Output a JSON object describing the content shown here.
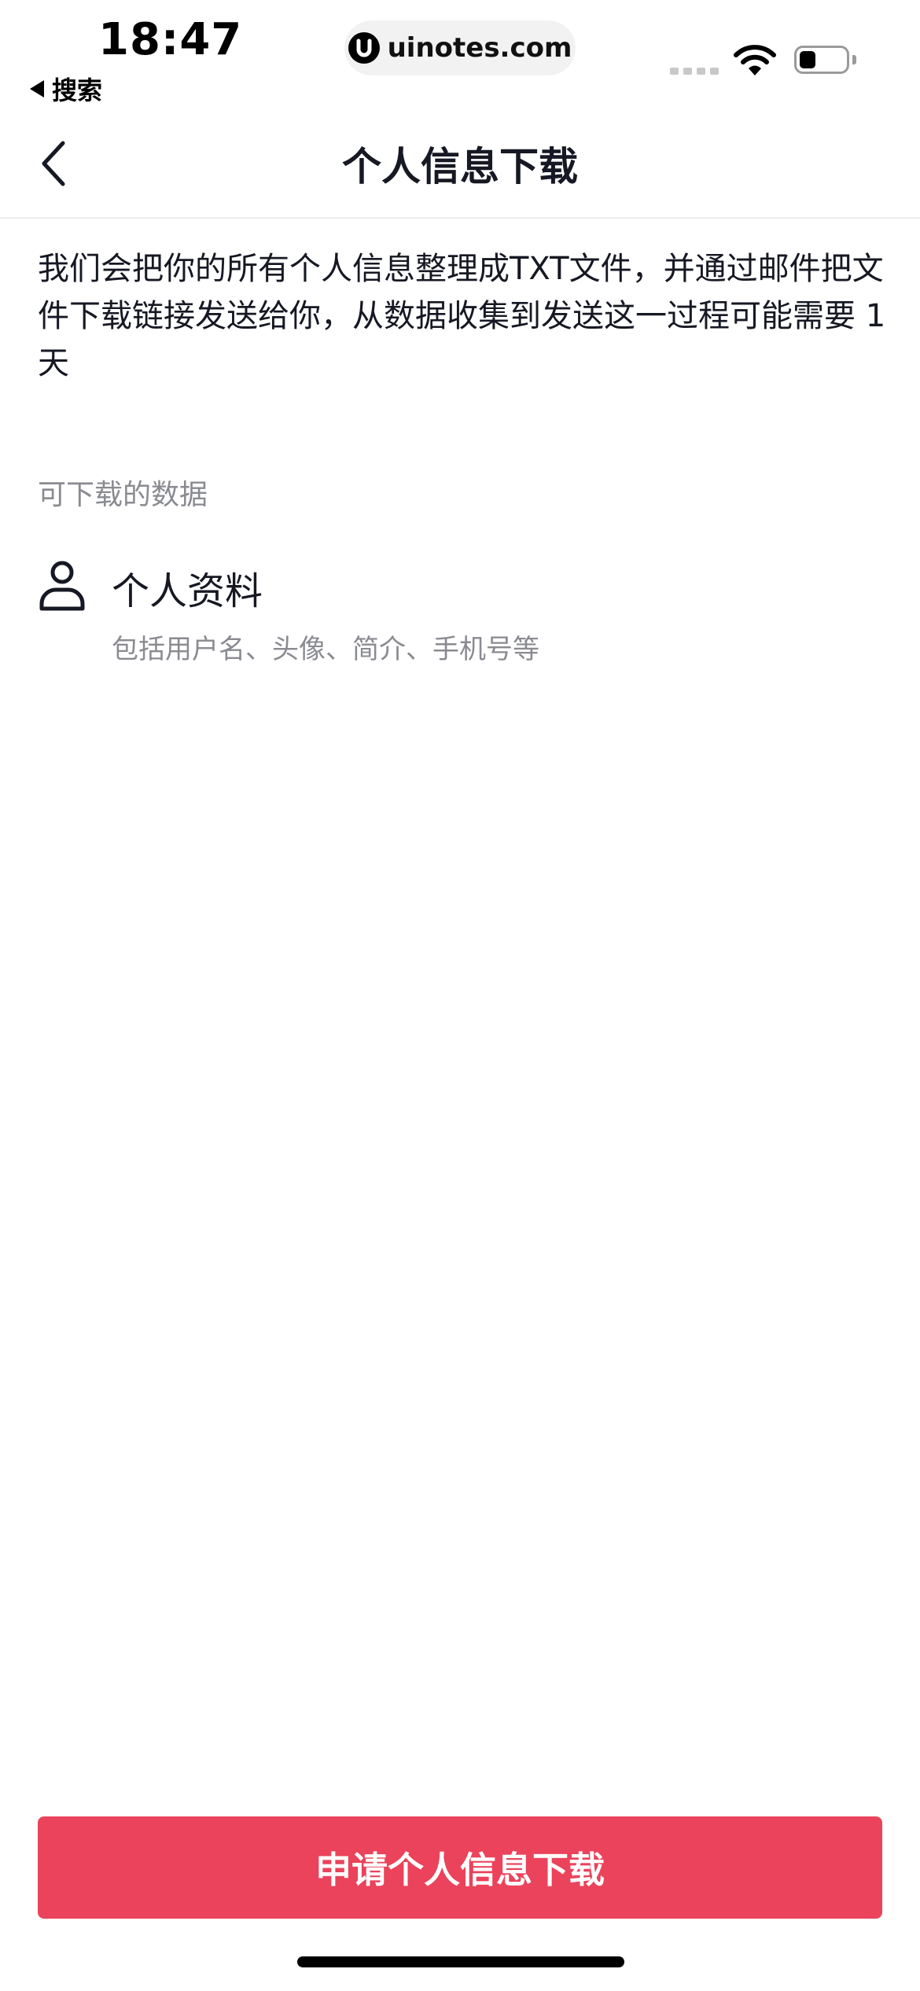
{
  "status_bar": {
    "time": "18:47",
    "back_label": "搜索",
    "url": "uinotes.com",
    "battery_level": 0.35
  },
  "nav": {
    "title": "个人信息下载"
  },
  "description": "我们会把你的所有个人信息整理成TXT文件，并通过邮件把文件下载链接发送给你，从数据收集到发送这一过程可能需要 1 天",
  "section_label": "可下载的数据",
  "data_items": [
    {
      "icon": "person-icon",
      "title": "个人资料",
      "subtitle": "包括用户名、头像、简介、手机号等"
    }
  ],
  "action": {
    "button_label": "申请个人信息下载"
  },
  "colors": {
    "accent": "#ea435b",
    "text_primary": "#161823",
    "text_secondary": "#8a8b91"
  }
}
